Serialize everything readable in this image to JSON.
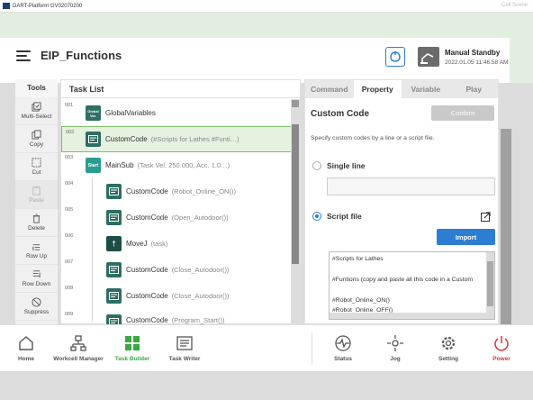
{
  "window": {
    "title": "DART-Platform GV02070200",
    "ghost_text": "Cell Scene"
  },
  "header": {
    "title": "EIP_Functions",
    "status_mode": "Manual Standby",
    "status_datetime": "2022.01.05 11:46:58 AM"
  },
  "tools": {
    "title": "Tools",
    "items": [
      {
        "label": "Multi-Select",
        "icon": "multi-select-icon",
        "enabled": true
      },
      {
        "label": "Copy",
        "icon": "copy-icon",
        "enabled": true
      },
      {
        "label": "Cut",
        "icon": "cut-icon",
        "enabled": true
      },
      {
        "label": "Paste",
        "icon": "paste-icon",
        "enabled": false
      },
      {
        "label": "Delete",
        "icon": "trash-icon",
        "enabled": true
      },
      {
        "label": "Row Up",
        "icon": "row-up-icon",
        "enabled": true
      },
      {
        "label": "Row Down",
        "icon": "row-down-icon",
        "enabled": true
      },
      {
        "label": "Suppress",
        "icon": "suppress-icon",
        "enabled": true
      }
    ]
  },
  "task_list": {
    "title": "Task List",
    "rows": [
      {
        "num": "001",
        "icon_text": "Global Var.",
        "icon": "global-variables-icon",
        "name": "GlobalVariables",
        "param": ""
      },
      {
        "num": "002",
        "icon_text": "",
        "icon": "custom-code-icon",
        "name": "CustomCode",
        "param": "(#Scripts for Lathes  #Funti…)"
      },
      {
        "num": "003",
        "icon_text": "Start",
        "icon": "start-icon",
        "name": "MainSub",
        "param": "(Task Vel. 250.000, Acc. 1.0…)"
      },
      {
        "num": "004",
        "icon_text": "",
        "icon": "custom-code-icon",
        "name": "CustomCode",
        "param": "(Robot_Online_ON())"
      },
      {
        "num": "005",
        "icon_text": "",
        "icon": "custom-code-icon",
        "name": "CustomCode",
        "param": "(Open_Autodoor())"
      },
      {
        "num": "006",
        "icon_text": "",
        "icon": "movej-icon",
        "name": "MoveJ",
        "param": "(task)"
      },
      {
        "num": "007",
        "icon_text": "",
        "icon": "custom-code-icon",
        "name": "CustomCode",
        "param": "(Close_Autodoor())"
      },
      {
        "num": "008",
        "icon_text": "",
        "icon": "custom-code-icon",
        "name": "CustomCode",
        "param": "(Close_Autodoor())"
      },
      {
        "num": "009",
        "icon_text": "",
        "icon": "custom-code-icon",
        "name": "CustomCode",
        "param": "(Program_Start())"
      }
    ]
  },
  "panel": {
    "tabs": [
      "Command",
      "Property",
      "Variable",
      "Play"
    ],
    "active_tab": "Property",
    "heading": "Custom Code",
    "confirm_label": "Confirm",
    "description": "Specify custom codes by a line or a script file.",
    "single_line_label": "Single line",
    "single_line_value": "",
    "script_file_label": "Script file",
    "import_label": "Import",
    "code_lines": [
      "#Scripts for Lathes",
      "",
      "#Funtions (copy and paste all this code in a Custom",
      "",
      "#Robot_Online_ON()",
      "#Robot_Online_OFF()"
    ]
  },
  "bottom_nav": [
    {
      "label": "Home",
      "icon": "home-icon"
    },
    {
      "label": "Workcell Manager",
      "icon": "workcell-icon"
    },
    {
      "label": "Task Builder",
      "icon": "task-builder-icon",
      "active": true
    },
    {
      "label": "Task Writer",
      "icon": "task-writer-icon"
    },
    {
      "label": "Status",
      "icon": "status-icon"
    },
    {
      "label": "Jog",
      "icon": "jog-icon"
    },
    {
      "label": "Setting",
      "icon": "gear-icon"
    },
    {
      "label": "Power",
      "icon": "power-icon"
    }
  ],
  "colors": {
    "accent_green": "#3aa842",
    "accent_blue": "#2d7dd2",
    "power_red": "#d9363e",
    "header_bg": "#e2efe0"
  }
}
